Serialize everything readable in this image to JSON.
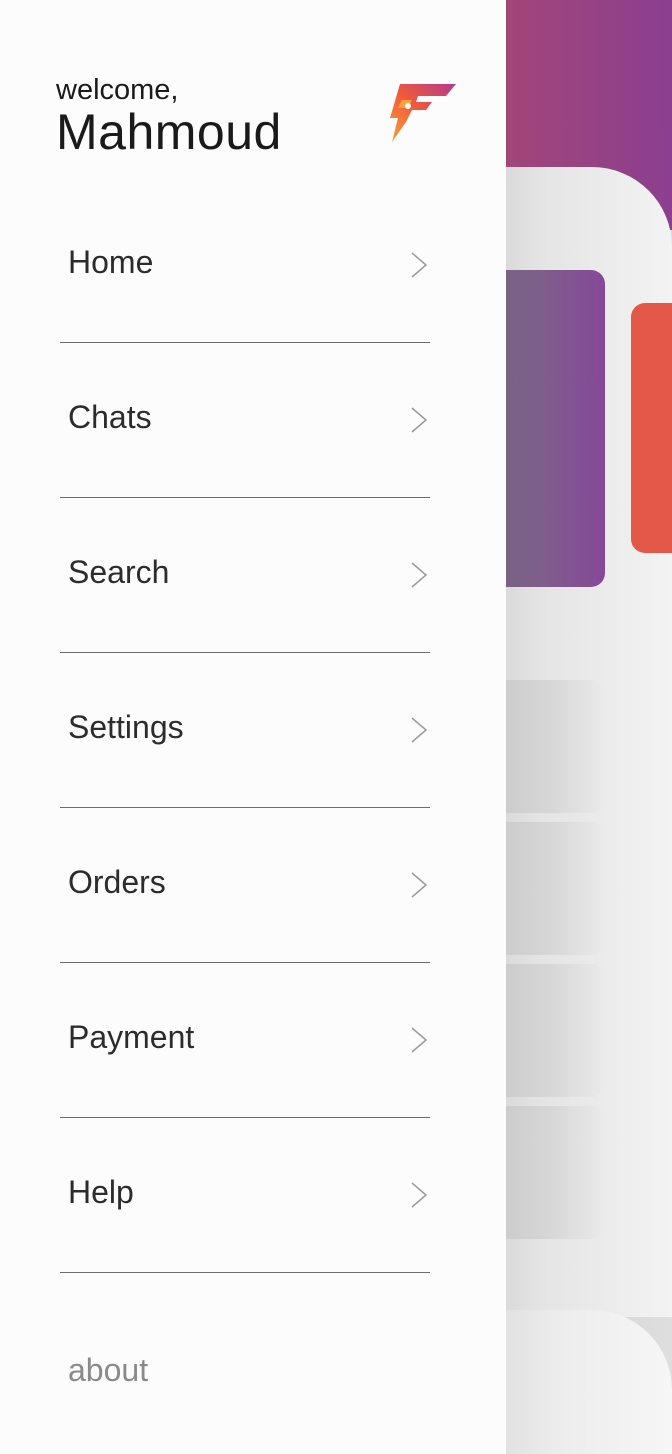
{
  "drawer": {
    "welcome_text": "welcome,",
    "user_name": "Mahmoud",
    "logo_icon": "flash-logo-icon",
    "items": [
      {
        "label": "Home",
        "icon": "chevron-right-icon"
      },
      {
        "label": "Chats",
        "icon": "chevron-right-icon"
      },
      {
        "label": "Search",
        "icon": "chevron-right-icon"
      },
      {
        "label": "Settings",
        "icon": "chevron-right-icon"
      },
      {
        "label": "Orders",
        "icon": "chevron-right-icon"
      },
      {
        "label": "Payment",
        "icon": "chevron-right-icon"
      },
      {
        "label": "Help",
        "icon": "chevron-right-icon"
      }
    ],
    "about_label": "about"
  },
  "colors": {
    "brand_orange": "#f0593b",
    "brand_purple": "#86489a",
    "accent_red": "#e4584a"
  }
}
